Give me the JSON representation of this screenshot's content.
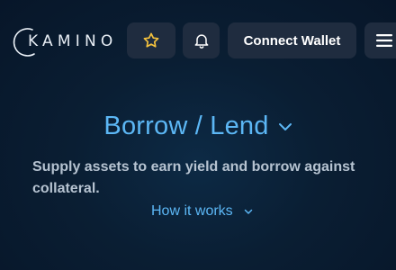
{
  "header": {
    "logo_text": "KAMINO",
    "favorites_icon": "star-icon",
    "notifications_icon": "bell-icon",
    "connect_wallet_label": "Connect Wallet",
    "menu_icon": "hamburger-menu-icon"
  },
  "hero": {
    "title": "Borrow / Lend",
    "title_dropdown_icon": "chevron-down-icon",
    "description": "Supply assets to earn yield and borrow against collateral.",
    "how_it_works_label": "How it works",
    "how_it_works_icon": "chevron-down-icon"
  },
  "colors": {
    "background": "#0a1e33",
    "button_bg": "#1f2c3f",
    "accent_blue": "#5cb7f5",
    "star_yellow": "#f4c23e",
    "body_text": "#b6c3d1"
  }
}
